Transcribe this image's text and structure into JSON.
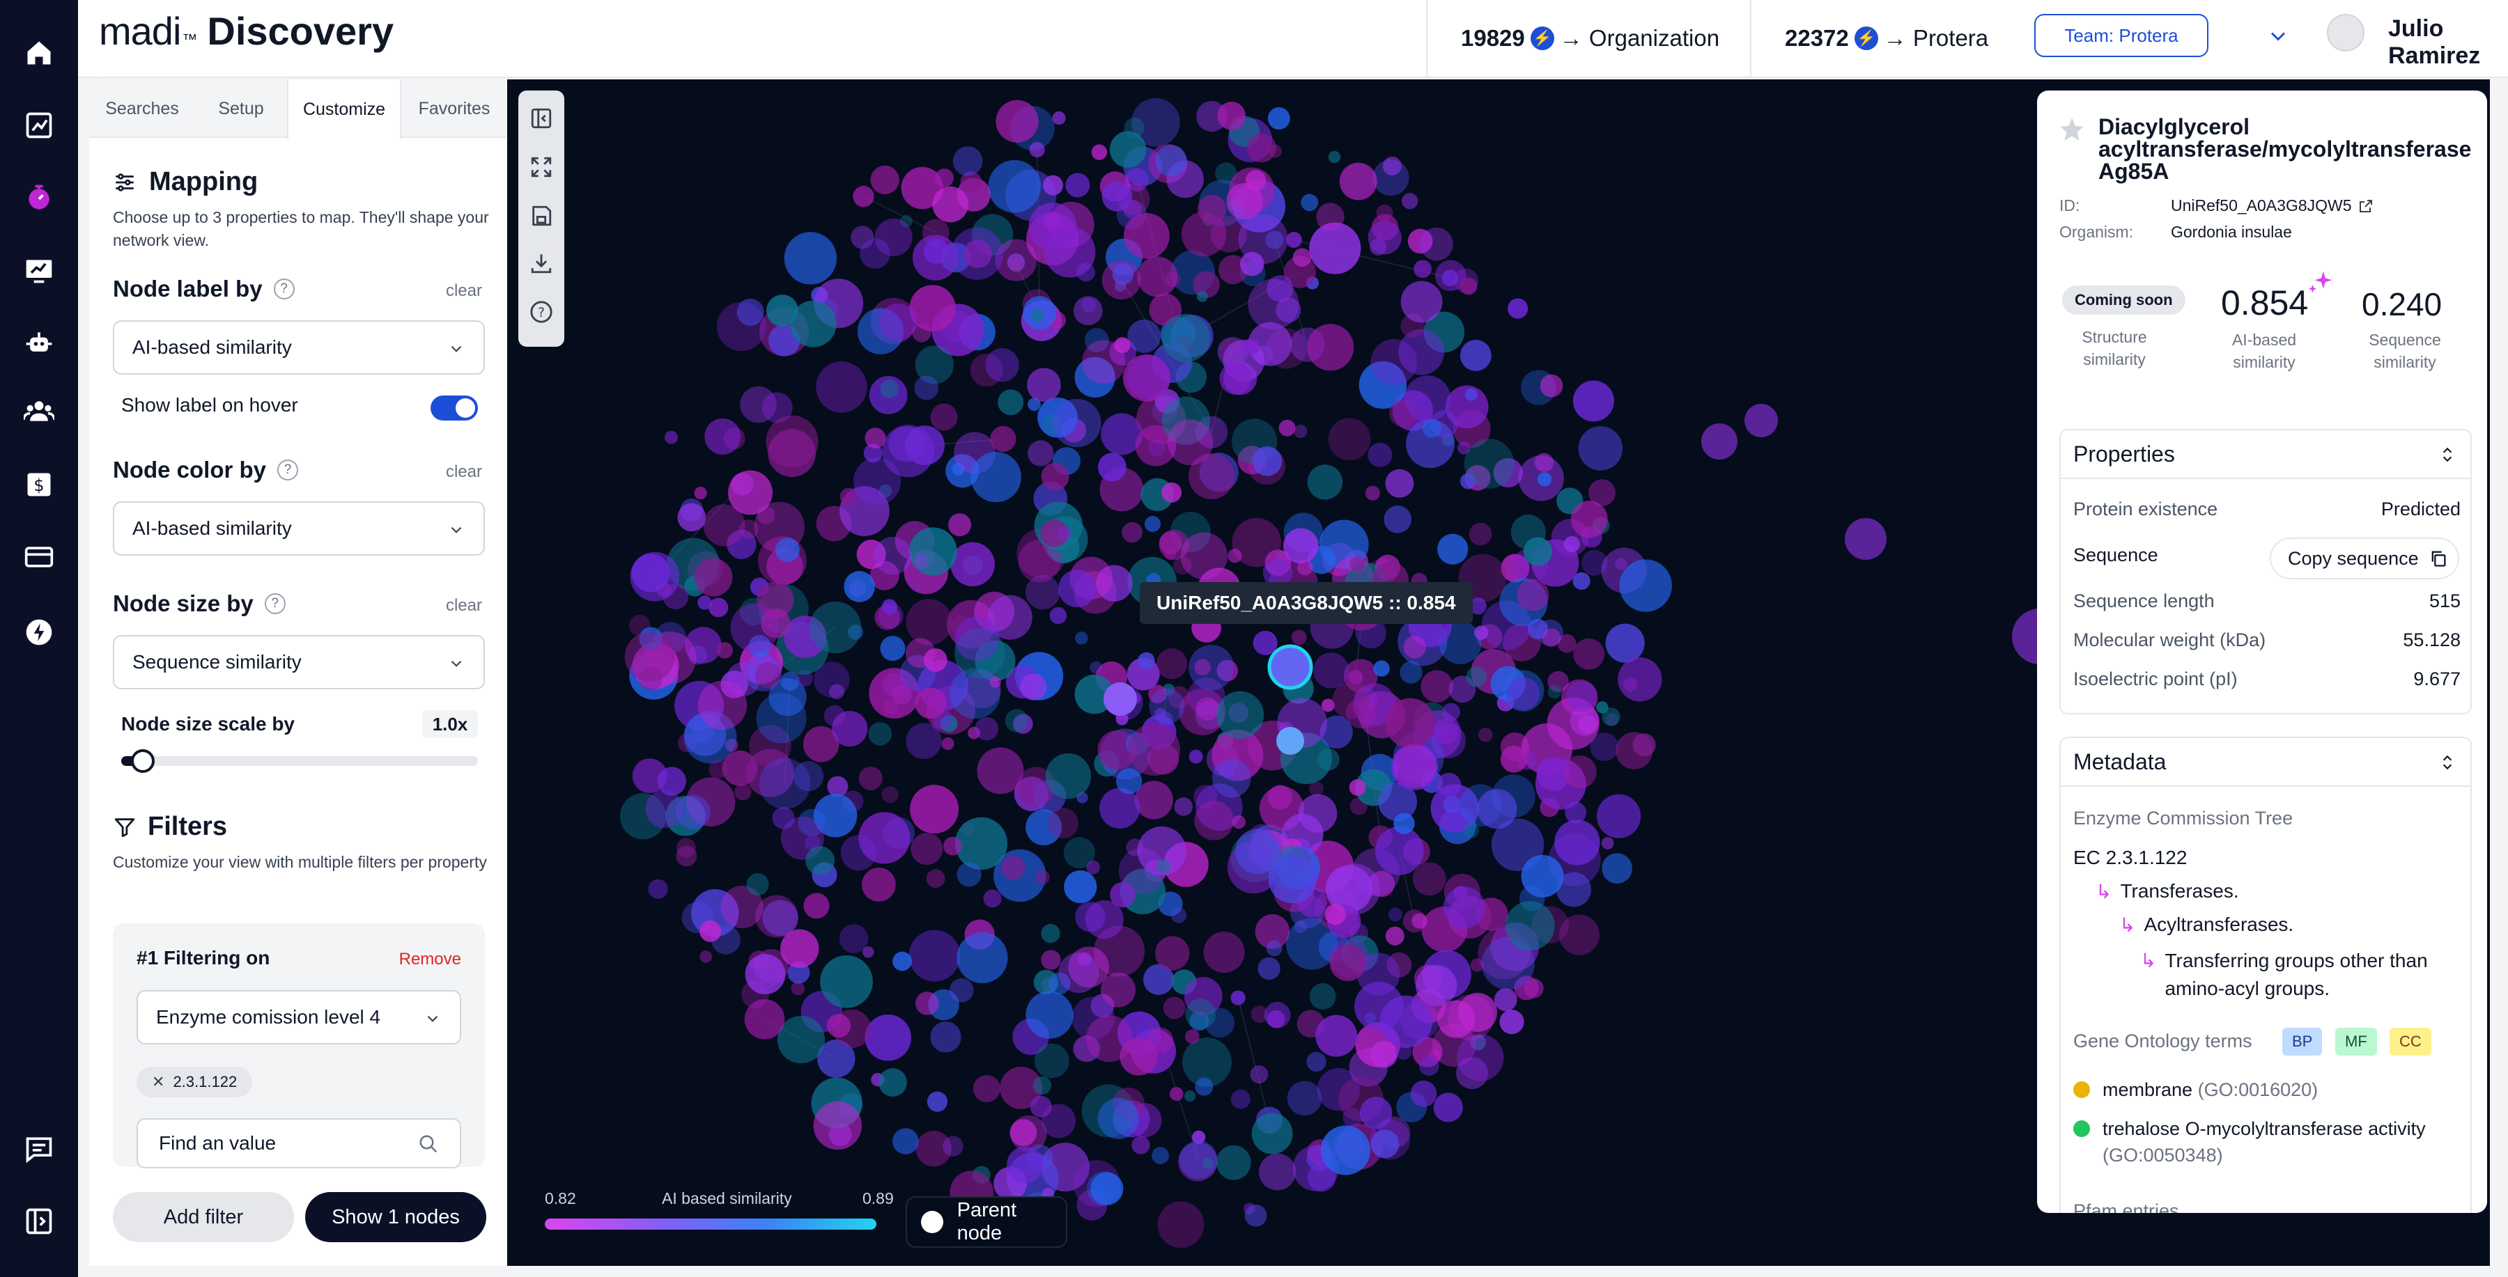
{
  "app": {
    "logo_main": "madi",
    "logo_tm": "™",
    "logo_product": "Discovery"
  },
  "header": {
    "credits_org_value": "19829",
    "credits_org_label": "→ Organization",
    "credits_team_value": "22372",
    "credits_team_label": "→ Protera",
    "team_label": "Team: Protera",
    "user_name": "Julio Ramirez"
  },
  "tabs": [
    "Searches",
    "Setup",
    "Customize",
    "Favorites"
  ],
  "active_tab": "Customize",
  "mapping": {
    "title": "Mapping",
    "subtitle": "Choose up to 3 properties to map. They'll shape your network view.",
    "node_label_title": "Node label by",
    "node_label_value": "AI-based similarity",
    "show_label_hover": "Show label on hover",
    "show_label_hover_on": true,
    "node_color_title": "Node color by",
    "node_color_value": "AI-based similarity",
    "node_size_title": "Node size by",
    "node_size_value": "Sequence similarity",
    "clear_label": "clear",
    "scale_label": "Node size scale by",
    "scale_value": "1.0x",
    "scale_fraction": 0.06
  },
  "filters": {
    "title": "Filters",
    "subtitle": "Customize your view with multiple filters per property",
    "filter_title": "#1 Filtering on",
    "remove_label": "Remove",
    "filter_field": "Enzyme comission level 4",
    "chip": "2.3.1.122",
    "find_placeholder": "Find an value",
    "add_filter": "Add filter",
    "show_nodes": "Show 1 nodes"
  },
  "graph": {
    "tooltip": "UniRef50_A0A3G8JQW5 :: 0.854",
    "legend_min": "0.82",
    "legend_title": "AI based similarity",
    "legend_max": "0.89",
    "parent_node_label": "Parent node"
  },
  "detail": {
    "title": "Diacylglycerol acyltransferase/mycolyltransferase Ag85A",
    "id_label": "ID:",
    "id_value": "UniRef50_A0A3G8JQW5",
    "organism_label": "Organism:",
    "organism_value": "Gordonia insulae",
    "structure_badge": "Coming soon",
    "structure_label": "Structure similarity",
    "ai_score": "0.854",
    "ai_label": "AI-based similarity",
    "seq_score": "0.240",
    "seq_label": "Sequence similarity",
    "properties_title": "Properties",
    "properties": [
      {
        "label": "Protein existence",
        "value": "Predicted"
      },
      {
        "label": "Sequence",
        "value": "Copy sequence"
      },
      {
        "label": "Sequence length",
        "value": "515"
      },
      {
        "label": "Molecular weight (kDa)",
        "value": "55.128"
      },
      {
        "label": "Isoelectric point (pI)",
        "value": "9.677"
      }
    ],
    "metadata_title": "Metadata",
    "ec_title": "Enzyme Commission Tree",
    "ec_root": "EC 2.3.1.122",
    "ec_l1": "Transferases.",
    "ec_l2": "Acyltransferases.",
    "ec_l3": "Transferring groups other than amino-acyl groups.",
    "go_title": "Gene Ontology terms",
    "go_badges": [
      "BP",
      "MF",
      "CC"
    ],
    "go_terms": [
      {
        "name": "membrane",
        "code": "(GO:0016020)",
        "color": "#eab308"
      },
      {
        "name": "trehalose O-mycolyltransferase activity",
        "code": "(GO:0050348)",
        "color": "#22c55e"
      }
    ],
    "pfam_title": "Pfam entries"
  }
}
